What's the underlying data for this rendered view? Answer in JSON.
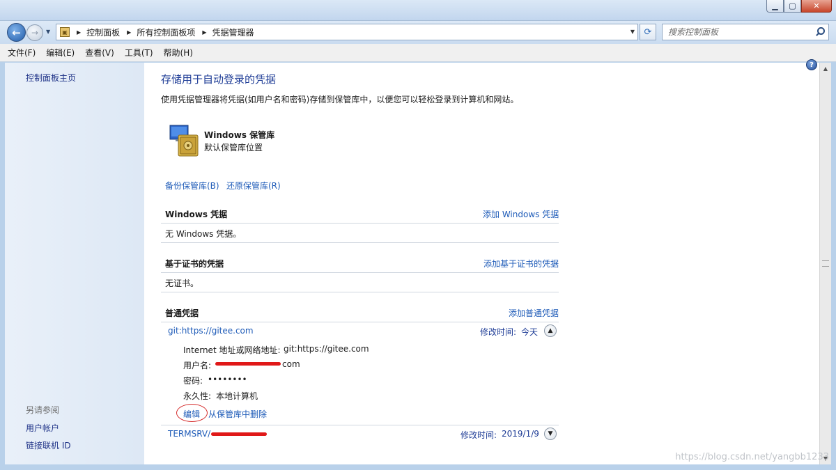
{
  "window": {
    "minimize": "0",
    "maximize": "1",
    "close": "r"
  },
  "address": {
    "crumbs": [
      "控制面板",
      "所有控制面板项",
      "凭据管理器"
    ]
  },
  "search": {
    "placeholder": "搜索控制面板"
  },
  "menu": [
    "文件(F)",
    "编辑(E)",
    "查看(V)",
    "工具(T)",
    "帮助(H)"
  ],
  "left": {
    "home": "控制面板主页",
    "see_also": "另请参阅",
    "links": [
      "用户帐户",
      "链接联机 ID"
    ]
  },
  "main": {
    "title": "存储用于自动登录的凭据",
    "description": "使用凭据管理器将凭据(如用户名和密码)存储到保管库中，以便您可以轻松登录到计算机和网站。",
    "vault": {
      "title": "Windows 保管库",
      "subtitle": "默认保管库位置"
    },
    "vault_actions": [
      "备份保管库(B)",
      "还原保管库(R)"
    ],
    "sections": {
      "windows": {
        "title": "Windows 凭据",
        "add": "添加 Windows 凭据",
        "empty": "无 Windows 凭据。"
      },
      "cert": {
        "title": "基于证书的凭据",
        "add": "添加基于证书的凭据",
        "empty": "无证书。"
      },
      "generic": {
        "title": "普通凭据",
        "add": "添加普通凭据"
      }
    },
    "credentials": [
      {
        "name": "git:https://gitee.com",
        "modified_label": "修改时间:",
        "modified": "今天",
        "details": {
          "address_label": "Internet 地址或网络地址:",
          "address": "git:https://gitee.com",
          "user_label": "用户名:",
          "user_suffix": "com",
          "password_label": "密码:",
          "password": "••••••••",
          "persist_label": "永久性:",
          "persist": "本地计算机"
        },
        "edit": "编辑",
        "remove": "从保管库中删除"
      },
      {
        "name": "TERMSRV/",
        "modified_label": "修改时间:",
        "modified": "2019/1/9"
      }
    ]
  },
  "watermark": "https://blog.csdn.net/yangbb1233"
}
